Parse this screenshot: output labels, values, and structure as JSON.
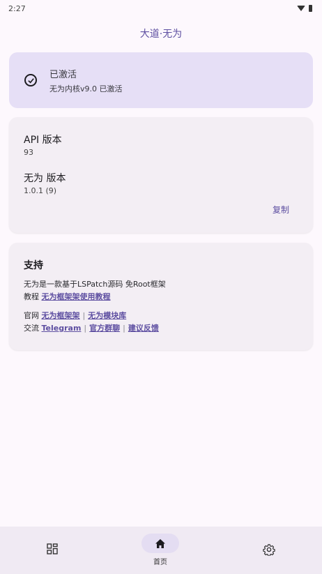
{
  "status_bar": {
    "time": "2:27"
  },
  "app_title": "大道·无为",
  "activation": {
    "title": "已激活",
    "subtitle": "无为内核v9.0 已激活",
    "icon": "check-circle-icon"
  },
  "versions": {
    "api_label": "API 版本",
    "api_value": "93",
    "app_label": "无为 版本",
    "app_value": "1.0.1 (9)",
    "copy_label": "复制"
  },
  "support": {
    "title": "支持",
    "description": "无为是一款基于LSPatch源码 免Root框架",
    "tutorial_prefix": "教程",
    "tutorial_link": "无为框架架使用教程",
    "site_prefix": "官网",
    "site_link_1": "无为框架架",
    "site_link_2": "无为模块库",
    "chat_prefix": "交流",
    "chat_link_1": "Telegram",
    "chat_link_2": "官方群聊",
    "chat_link_3": "建议反馈",
    "separator": "|"
  },
  "bottom_nav": {
    "items": [
      {
        "icon": "apps-grid-icon",
        "label": ""
      },
      {
        "icon": "home-icon",
        "label": "首页"
      },
      {
        "icon": "gear-icon",
        "label": ""
      }
    ]
  },
  "colors": {
    "accent": "#5e4fa1",
    "activated_card": "#e6dff6",
    "card": "#f3eef4",
    "background": "#fdf8fd"
  }
}
